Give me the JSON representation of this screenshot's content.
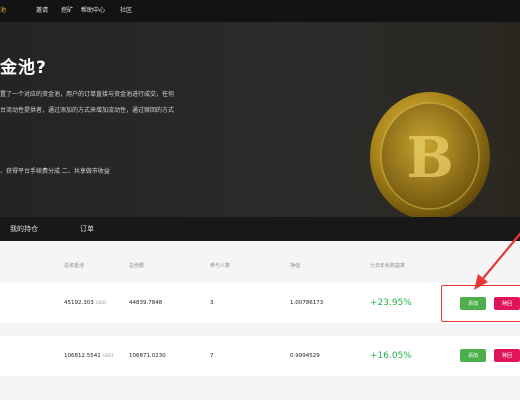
{
  "nav": {
    "items": [
      {
        "label": "池",
        "active": true
      },
      {
        "label": "邀请",
        "active": false
      },
      {
        "label": "挖矿",
        "active": false
      },
      {
        "label": "帮助中心",
        "active": false
      },
      {
        "label": "社区",
        "active": false
      }
    ]
  },
  "hero": {
    "title": "金池?",
    "lines": [
      "置了一个对应的资金池，用户的订单直接与资金池进行成交，任何",
      "台流动性提供者，通过添加的方式来增加流动性，通过赎回的方式",
      "、获得平台手续费分成 二、共享做市收益"
    ],
    "coin_letter": "B"
  },
  "tabs": [
    "我的持仓",
    "订单"
  ],
  "table": {
    "headers": [
      "总资金池",
      "总份额",
      "参与人数",
      "净值",
      "七日年化收益率"
    ],
    "rows": [
      {
        "pool": "45192.303",
        "pool_unit": "USDC",
        "shares": "44839.7848",
        "participants": "3",
        "nav": "1.00786173",
        "apy": "+23.95%",
        "add": "添加",
        "redeem": "赎回"
      },
      {
        "pool": "106812.5541",
        "pool_unit": "USDT",
        "shares": "106871.0230",
        "participants": "7",
        "nav": "0.9994529",
        "apy": "+16.05%",
        "add": "添加",
        "redeem": "赎回"
      }
    ]
  },
  "colors": {
    "accent": "#f2b134",
    "positive": "#26b24a",
    "add_button": "#4cae4c",
    "redeem_button": "#e0145a",
    "annotation": "#e53935"
  }
}
